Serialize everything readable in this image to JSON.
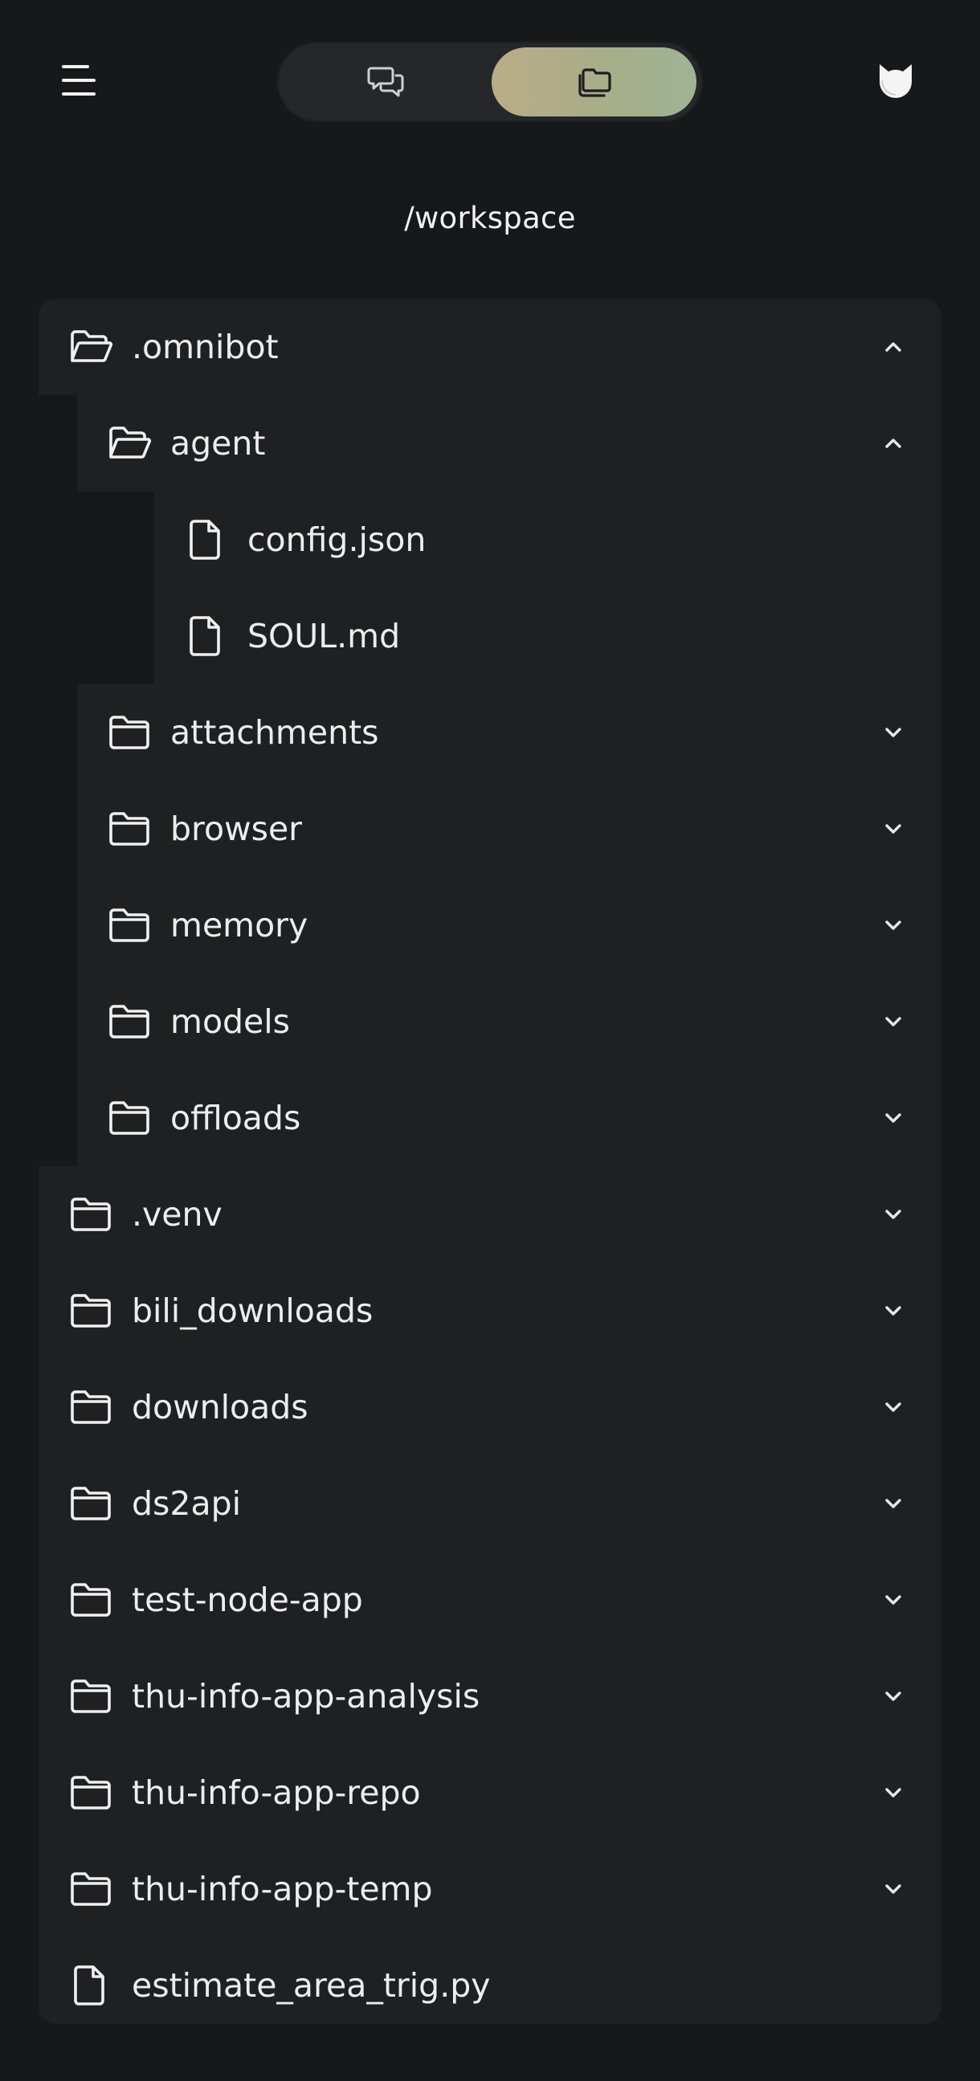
{
  "header": {
    "menu_icon": "hamburger-menu-icon",
    "tabs": [
      {
        "name": "chat",
        "icon": "chat-bubbles-icon",
        "selected": false
      },
      {
        "name": "files",
        "icon": "folders-icon",
        "selected": true
      }
    ],
    "theme_icon": "cat-avatar-icon",
    "accent_gradient": [
      "#b9ad86",
      "#9fb494"
    ]
  },
  "path": "/workspace",
  "tree": {
    "items": [
      {
        "label": ".omnibot",
        "type": "folder",
        "expanded": true,
        "depth": 0
      },
      {
        "label": "agent",
        "type": "folder",
        "expanded": true,
        "depth": 1
      },
      {
        "label": "config.json",
        "type": "file",
        "depth": 2
      },
      {
        "label": "SOUL.md",
        "type": "file",
        "depth": 2
      },
      {
        "label": "attachments",
        "type": "folder",
        "expanded": false,
        "depth": 1
      },
      {
        "label": "browser",
        "type": "folder",
        "expanded": false,
        "depth": 1
      },
      {
        "label": "memory",
        "type": "folder",
        "expanded": false,
        "depth": 1
      },
      {
        "label": "models",
        "type": "folder",
        "expanded": false,
        "depth": 1
      },
      {
        "label": "offloads",
        "type": "folder",
        "expanded": false,
        "depth": 1
      },
      {
        "label": ".venv",
        "type": "folder",
        "expanded": false,
        "depth": 0
      },
      {
        "label": "bili_downloads",
        "type": "folder",
        "expanded": false,
        "depth": 0
      },
      {
        "label": "downloads",
        "type": "folder",
        "expanded": false,
        "depth": 0
      },
      {
        "label": "ds2api",
        "type": "folder",
        "expanded": false,
        "depth": 0
      },
      {
        "label": "test-node-app",
        "type": "folder",
        "expanded": false,
        "depth": 0
      },
      {
        "label": "thu-info-app-analysis",
        "type": "folder",
        "expanded": false,
        "depth": 0
      },
      {
        "label": "thu-info-app-repo",
        "type": "folder",
        "expanded": false,
        "depth": 0
      },
      {
        "label": "thu-info-app-temp",
        "type": "folder",
        "expanded": false,
        "depth": 0
      },
      {
        "label": "estimate_area_trig.py",
        "type": "file",
        "depth": 0
      }
    ]
  }
}
